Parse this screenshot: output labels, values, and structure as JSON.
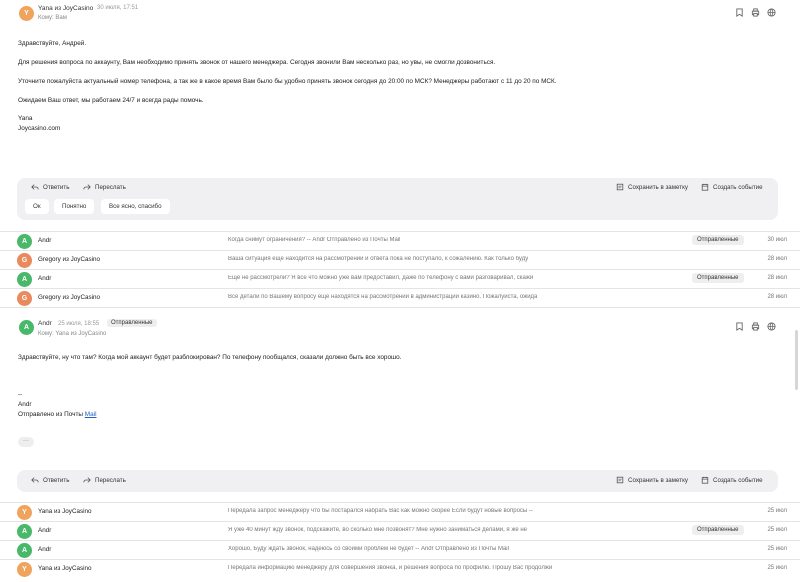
{
  "message1": {
    "avatar_letter": "Y",
    "sender": "Yana из JoyCasino",
    "date": "30 июля, 17:51",
    "to": "Кому: Вам",
    "body": [
      "Здравствуйте, Андрей.",
      "Для решения вопроса по аккаунту, Вам необходимо принять звонок от нашего менеджера. Сегодня звонили Вам несколько раз, но увы, не смогли дозвониться.",
      "Уточните пожалуйста актуальный номер телефона, а так же в какое время Вам было бы удобно принять звонок сегодня до 20:00 по МСК? Менеджеры работают с 11 до 20 по МСК.",
      "Ожидаем Ваш ответ, мы работаем 24/7 и всегда рады помочь.",
      "Yana",
      "Joycasino.com"
    ],
    "actions": {
      "reply": "Ответить",
      "forward": "Переслать",
      "save_note": "Сохранить в заметку",
      "create_event": "Создать событие"
    },
    "quick_replies": [
      "Ок",
      "Понятно",
      "Все ясно, спасибо"
    ]
  },
  "rows_top": [
    {
      "avatar": "A",
      "sender": "Andr",
      "snippet": "Когда снимут ограничения? -- Andr Отправлено из Почты Mail",
      "badge": "Отправленные",
      "date": "30 июл"
    },
    {
      "avatar": "G",
      "sender": "Gregory из JoyCasino",
      "snippet": "Ваша ситуация еще находится на рассмотрении и ответа пока не поступало, к сожалению. Как только буду",
      "badge": "",
      "date": "28 июл"
    },
    {
      "avatar": "A",
      "sender": "Andr",
      "snippet": "Еще не рассмотрели? Я все что можно уже вам предоставил, даже по телефону с вами разговаривал, скажи",
      "badge": "Отправленные",
      "date": "28 июл"
    },
    {
      "avatar": "G",
      "sender": "Gregory из JoyCasino",
      "snippet": "Все детали по Вашему вопросу еще находятся на рассмотрении в администрации казино. Пожалуйста, ожида",
      "badge": "",
      "date": "28 июл"
    }
  ],
  "message2": {
    "avatar_letter": "A",
    "sender": "Andr",
    "date": "25 июля, 18:55",
    "badge": "Отправленные",
    "to": "Кому: Yana из JoyCasino",
    "body": "Здравствуйте, ну что там? Когда мой аккаунт будет разблокирован? По телефону пообщался, сказали должно быть все хорошо.",
    "sig_dash": "--",
    "sig_name": "Andr",
    "sig_sent": "Отправлено из Почты ",
    "sig_link": "Mail",
    "more": "···",
    "actions": {
      "reply": "Ответить",
      "forward": "Переслать",
      "save_note": "Сохранить в заметку",
      "create_event": "Создать событие"
    }
  },
  "rows_bottom": [
    {
      "avatar": "Y",
      "sender": "Yana из JoyCasino",
      "snippet": "Передала запрос менеджеру что бы постарался набрать Вас как можно скорее Если будут новые вопросы --",
      "badge": "",
      "date": "25 июл"
    },
    {
      "avatar": "A",
      "sender": "Andr",
      "snippet": "Я уже 40 минут жду звонок, подскажите, во сколько мне позвонят? Мне нужно заниматься делами, я же не",
      "badge": "Отправленные",
      "date": "25 июл"
    },
    {
      "avatar": "A",
      "sender": "Andr",
      "snippet": "Хорошо, Буду ждать звонок, надеюсь со своими проблем не будет -- Andr Отправлено из Почты Mail",
      "badge": "",
      "date": "25 июл"
    },
    {
      "avatar": "Y",
      "sender": "Yana из JoyCasino",
      "snippet": "Передала информацию менеджеру для совершения звонка, и решения вопроса по профилю. Прошу Вас продолжи",
      "badge": "",
      "date": "25 июл"
    }
  ],
  "colors": {
    "avatar_y": "#f0a35c",
    "avatar_a": "#49b86a",
    "avatar_g": "#e98a5c",
    "panel": "#f0f0f3",
    "link": "#2060c0"
  },
  "icons": [
    "reply-icon",
    "forward-icon",
    "note-icon",
    "calendar-icon",
    "bookmark-icon",
    "print-icon",
    "globe-icon"
  ]
}
